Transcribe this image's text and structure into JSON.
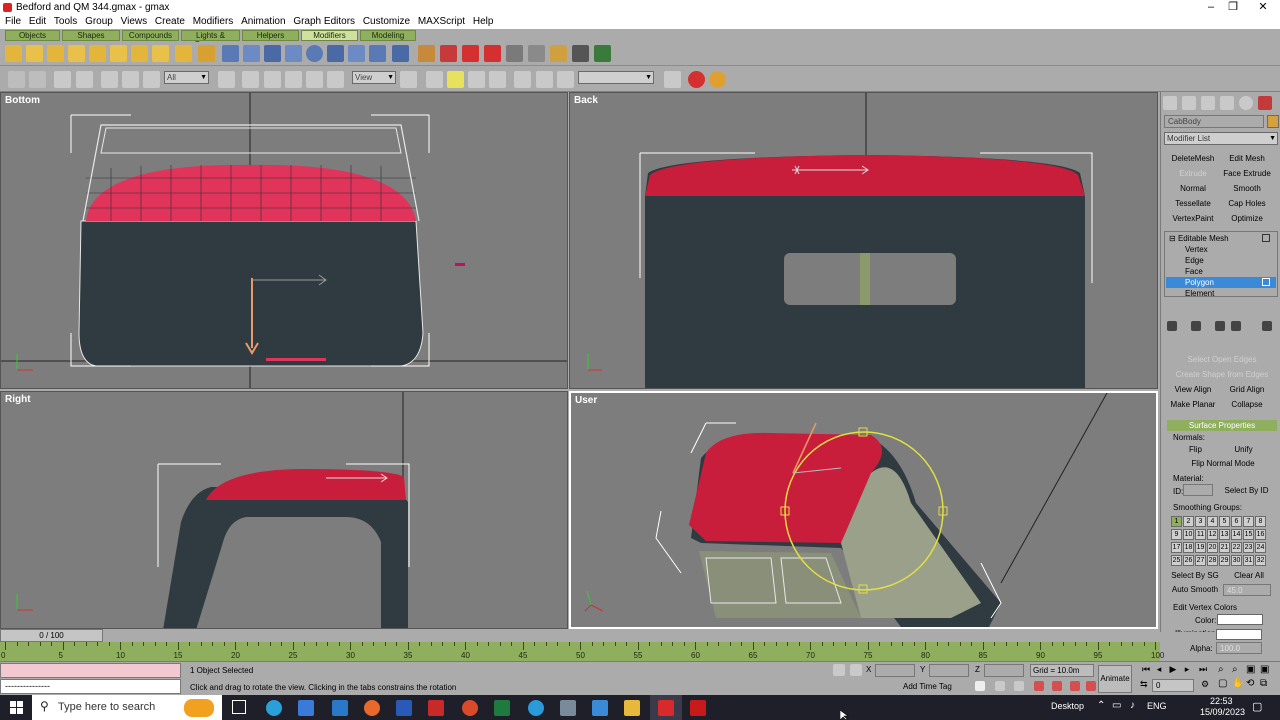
{
  "window": {
    "title": "Bedford and QM 344.gmax - gmax"
  },
  "menu": [
    "File",
    "Edit",
    "Tools",
    "Group",
    "Views",
    "Create",
    "Modifiers",
    "Animation",
    "Graph Editors",
    "Customize",
    "MAXScript",
    "Help"
  ],
  "tabs": [
    "Objects",
    "Shapes",
    "Compounds",
    "Lights & Cameras",
    "Helpers",
    "Modifiers",
    "Modeling"
  ],
  "toolbar": {
    "selection_filter": "All",
    "ref_coord": "View"
  },
  "viewports": {
    "bottom": "Bottom",
    "back": "Back",
    "right": "Right",
    "user": "User"
  },
  "command_panel": {
    "object_name": "CabBody",
    "modifier_list": "Modifier List",
    "modifier_buttons": [
      "DeleteMesh",
      "Edit Mesh",
      "Extrude",
      "Face Extrude",
      "Normal",
      "Smooth",
      "Tessellate",
      "Cap Holes",
      "VertexPaint",
      "Optimize"
    ],
    "stack": {
      "root": "Editable Mesh",
      "items": [
        "Vertex",
        "Edge",
        "Face",
        "Polygon",
        "Element"
      ],
      "selected": "Polygon"
    },
    "geom_buttons": [
      "Select Open Edges",
      "Create Shape from Edges",
      "View Align",
      "Grid Align",
      "Make Planar",
      "Collapse"
    ],
    "surface_header": "Surface Properties",
    "normals_label": "Normals:",
    "flip": "Flip",
    "unify": "Unify",
    "flip_normal_mode": "Flip Normal Mode",
    "material_label": "Material:",
    "id_label": "ID:",
    "select_by_id": "Select By ID",
    "smoothing_label": "Smoothing Groups:",
    "smoothing_groups": [
      "1",
      "2",
      "3",
      "4",
      "5",
      "6",
      "7",
      "8",
      "9",
      "10",
      "11",
      "12",
      "13",
      "14",
      "15",
      "16",
      "17",
      "18",
      "19",
      "20",
      "21",
      "22",
      "23",
      "24",
      "25",
      "26",
      "27",
      "28",
      "29",
      "30",
      "31",
      "32"
    ],
    "select_by_sg": "Select By SG",
    "clear_all": "Clear All",
    "auto_smooth": "Auto Smooth",
    "auto_smooth_value": "45.0",
    "edit_vertex_colors": "Edit Vertex Colors",
    "color_label": "Color:",
    "illumination_label": "Illumination:",
    "alpha_label": "Alpha:",
    "alpha_value": "100.0"
  },
  "timeline": {
    "frame": "0 / 100",
    "ticks": [
      "0",
      "5",
      "10",
      "15",
      "20",
      "25",
      "30",
      "35",
      "40",
      "45",
      "50",
      "55",
      "60",
      "65",
      "70",
      "75",
      "80",
      "85",
      "90",
      "95",
      "100"
    ]
  },
  "status": {
    "selection": "1 Object Selected",
    "prompt": "Click and drag to rotate the view.  Clicking in the tabs constrains the rotation",
    "x_label": "X",
    "y_label": "Y",
    "z_label": "Z",
    "grid": "Grid = 10.0m",
    "add_time_tag": "Add Time Tag",
    "animate": "Animate",
    "frame_field": "0",
    "maxscript": "---------------"
  },
  "taskbar": {
    "search_placeholder": "Type here to search",
    "desktop": "Desktop",
    "lang": "ENG",
    "time": "22:53",
    "date": "15/09/2023"
  }
}
